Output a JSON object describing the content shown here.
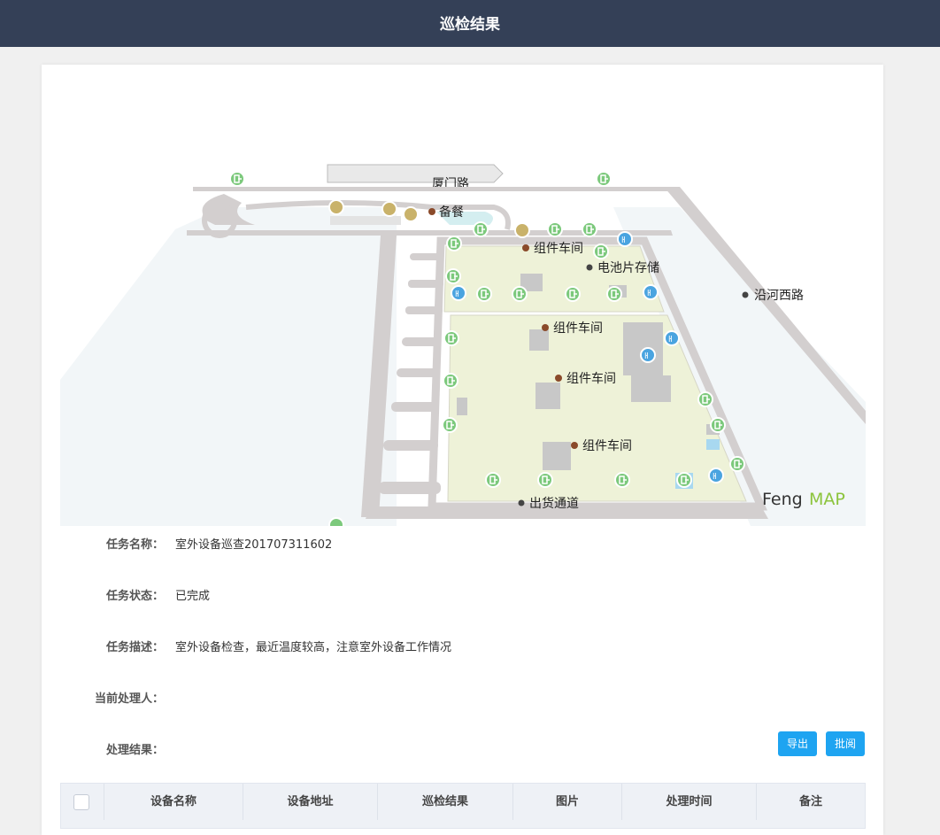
{
  "header": {
    "title": "巡检结果"
  },
  "map": {
    "watermark_a": "Feng",
    "watermark_b": "MAP",
    "labels": [
      "备餐",
      "组件车间",
      "电池片存储",
      "沿河西路",
      "组件车间",
      "组件车间",
      "组件车间",
      "出货通道"
    ],
    "top_road_label": "厦门路"
  },
  "task": {
    "name_label": "任务名称：",
    "name": "室外设备巡查201707311602",
    "status_label": "任务状态：",
    "status": "已完成",
    "desc_label": "任务描述：",
    "desc": "室外设备检查，最近温度较高，注意室外设备工作情况",
    "handler_label": "当前处理人：",
    "handler": "",
    "result_label": "处理结果："
  },
  "actions": {
    "export_label": "导出",
    "review_label": "批阅"
  },
  "table": {
    "columns": [
      "设备名称",
      "设备地址",
      "巡检结果",
      "图片",
      "处理时间",
      "备注"
    ]
  },
  "colors": {
    "header_bg": "#344057",
    "button": "#1ea4f1",
    "zone": "#eef2d8",
    "road": "#d3cfcf",
    "exit_icon": "#7cc97c",
    "restroom_icon": "#4aa4e0"
  }
}
